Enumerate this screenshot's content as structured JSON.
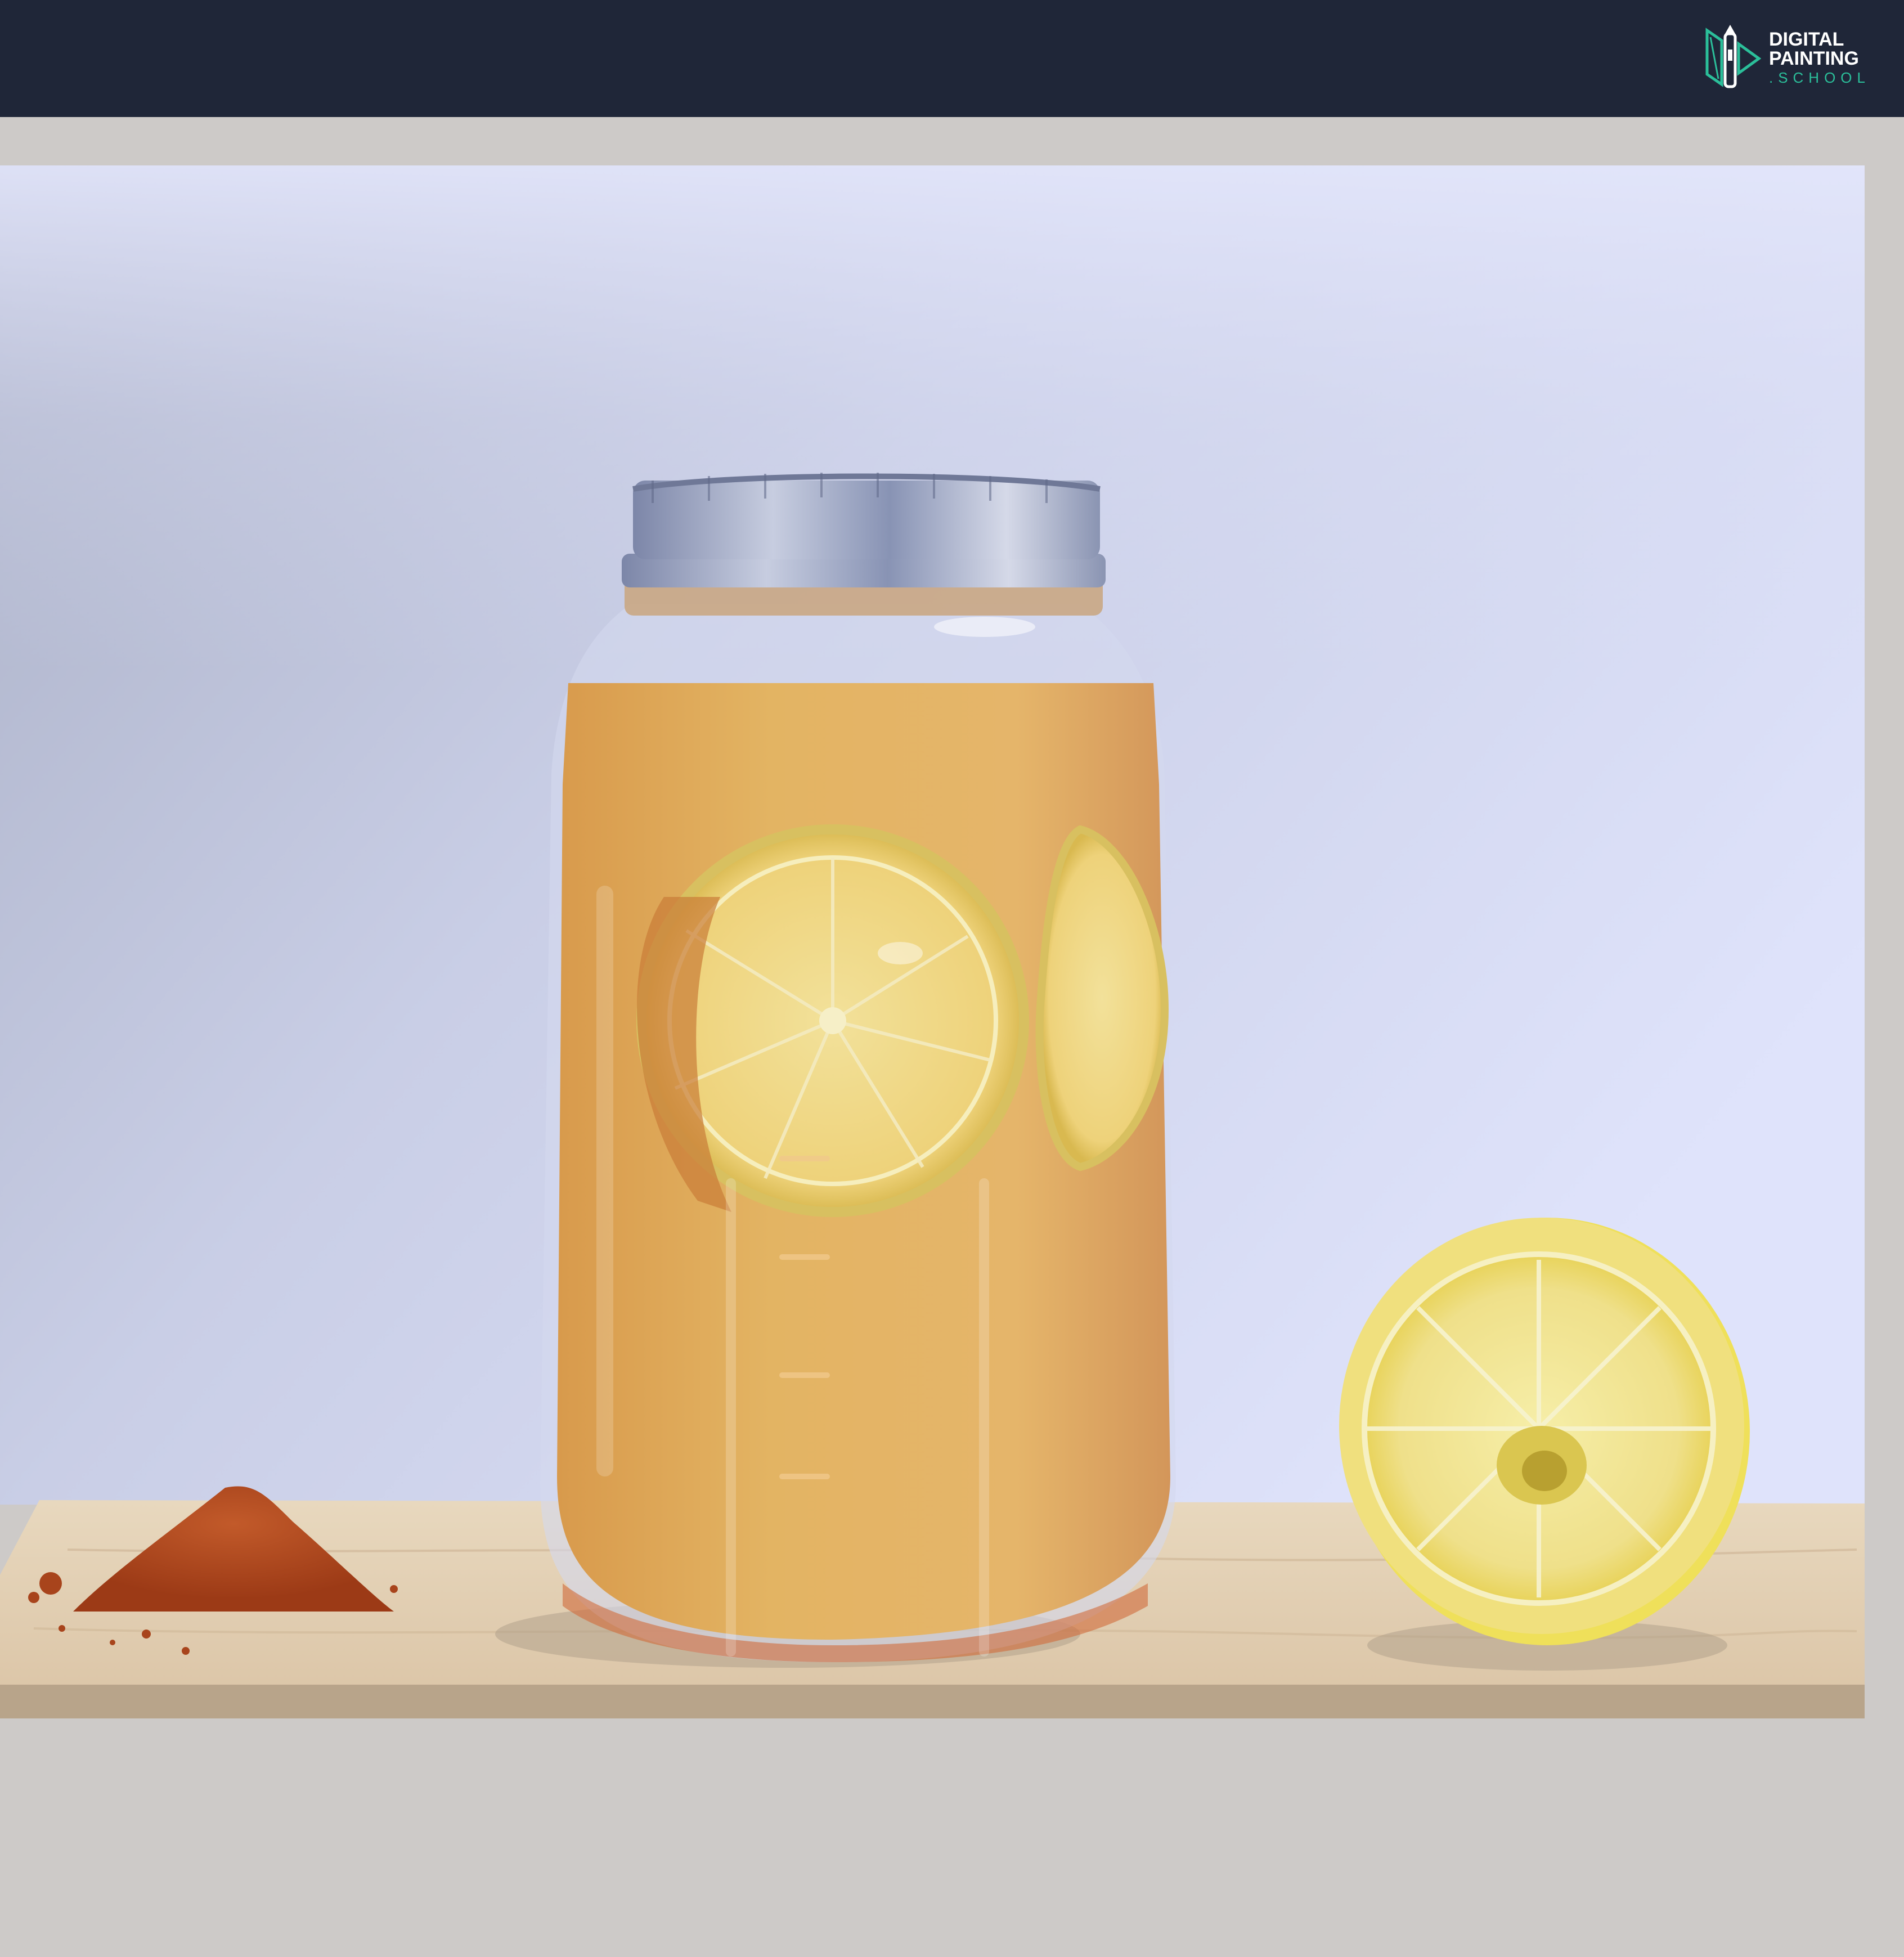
{
  "brand": {
    "line1": "DIGITAL",
    "line2": "PAINTING",
    "line3": ".SCHOOL",
    "icon": "pen-nib-icon",
    "accent_color": "#2bbf9a"
  },
  "colors": {
    "header": "#1f2638",
    "frame": "#cdcac8",
    "wall": "#dfe3f8",
    "shelf": "#e3cfb3",
    "liquid": "#e2ad5c",
    "lid": "#9aa4bf",
    "lemon": "#f3e27a",
    "spice": "#b7471c"
  },
  "artwork": {
    "subject": "Mason jar of lemon tea with a halved lemon and a pile of spice on a wooden shelf"
  }
}
